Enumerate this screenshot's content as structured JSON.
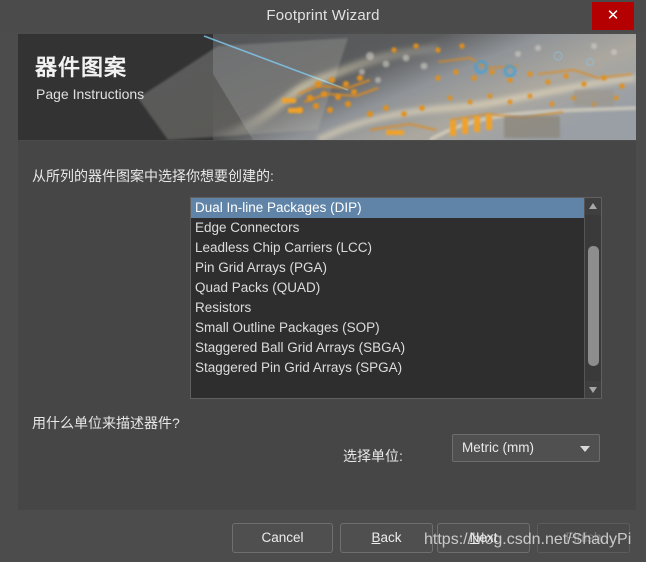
{
  "window": {
    "title": "Footprint Wizard",
    "close_label": "✕"
  },
  "banner": {
    "title": "器件图案",
    "subtitle": "Page Instructions"
  },
  "content": {
    "prompt_list": "从所列的器件图案中选择你想要创建的:",
    "prompt_units": "用什么单位来描述器件?",
    "unit_label": "选择单位:",
    "unit_value": "Metric (mm)",
    "unit_options": [
      "Metric (mm)"
    ],
    "list": {
      "selected_index": 0,
      "items": [
        "Dual In-line Packages (DIP)",
        "Edge Connectors",
        "Leadless Chip Carriers (LCC)",
        "Pin Grid Arrays (PGA)",
        "Quad Packs (QUAD)",
        "Resistors",
        "Small Outline Packages (SOP)",
        "Staggered Ball Grid Arrays (SBGA)",
        "Staggered Pin Grid Arrays (SPGA)"
      ]
    }
  },
  "footer": {
    "cancel_label": "Cancel",
    "back_label": "Back",
    "back_mnemonic": "B",
    "next_label": "Next",
    "next_mnemonic": "N",
    "finish_label": "Finish",
    "finish_enabled": false
  },
  "overlay": {
    "watermark": "https://blog.csdn.net/ShadyPi"
  },
  "colors": {
    "titlebar_bg": "#4b4b4b",
    "close_bg": "#b40000",
    "banner_bg": "#333333",
    "content_bg": "#464646",
    "listbox_bg": "#2e2e2e",
    "selection_bg": "#5f84a8",
    "button_bg": "#4f4f4f",
    "text": "#e8e8e8"
  }
}
